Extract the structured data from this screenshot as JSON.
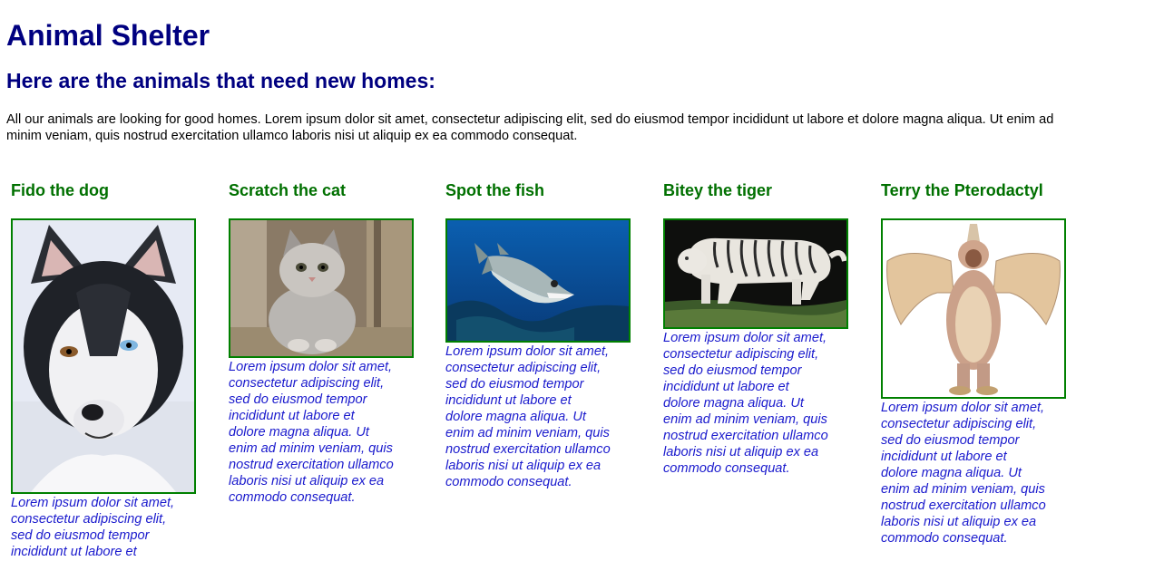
{
  "page": {
    "title": "Animal Shelter",
    "subtitle": "Here are the animals that need new homes:",
    "intro_line1": "All our animals are looking for good homes. Lorem ipsum dolor sit amet, consectetur adipiscing elit, sed do eiusmod tempor incididunt ut labore et dolore magna aliqua. Ut enim ad",
    "intro_line2": "minim veniam, quis nostrud exercitation ullamco laboris nisi ut aliquip ex ea commodo consequat."
  },
  "animals": [
    {
      "name": "Fido the dog",
      "image": "husky-dog-photo",
      "desc_lines": [
        "Lorem ipsum dolor sit amet,",
        "consectetur adipiscing elit,",
        "sed do eiusmod tempor",
        "incididunt ut labore et"
      ]
    },
    {
      "name": "Scratch the cat",
      "image": "kitten-photo",
      "desc_lines": [
        "Lorem ipsum dolor sit amet,",
        "consectetur adipiscing elit,",
        "sed do eiusmod tempor",
        "incididunt ut labore et",
        "dolore magna aliqua. Ut",
        "enim ad minim veniam, quis",
        "nostrud exercitation ullamco",
        "laboris nisi ut aliquip ex ea",
        "commodo consequat."
      ]
    },
    {
      "name": "Spot the fish",
      "image": "barracuda-fish-photo",
      "desc_lines": [
        "Lorem ipsum dolor sit amet,",
        "consectetur adipiscing elit,",
        "sed do eiusmod tempor",
        "incididunt ut labore et",
        "dolore magna aliqua. Ut",
        "enim ad minim veniam, quis",
        "nostrud exercitation ullamco",
        "laboris nisi ut aliquip ex ea",
        "commodo consequat."
      ]
    },
    {
      "name": "Bitey the tiger",
      "image": "white-tiger-photo",
      "desc_lines": [
        "Lorem ipsum dolor sit amet,",
        "consectetur adipiscing elit,",
        "sed do eiusmod tempor",
        "incididunt ut labore et",
        "dolore magna aliqua. Ut",
        "enim ad minim veniam, quis",
        "nostrud exercitation ullamco",
        "laboris nisi ut aliquip ex ea",
        "commodo consequat."
      ]
    },
    {
      "name": "Terry the Pterodactyl",
      "image": "pterodactyl-costume-photo",
      "desc_lines": [
        "Lorem ipsum dolor sit amet,",
        "consectetur adipiscing elit,",
        "sed do eiusmod tempor",
        "incididunt ut labore et",
        "dolore magna aliqua. Ut",
        "enim ad minim veniam, quis",
        "nostrud exercitation ullamco",
        "laboris nisi ut aliquip ex ea",
        "commodo consequat."
      ]
    }
  ],
  "colors": {
    "heading": "#000080",
    "animal_name": "#007000",
    "frame_border": "#008000",
    "description": "#1a1acd"
  }
}
